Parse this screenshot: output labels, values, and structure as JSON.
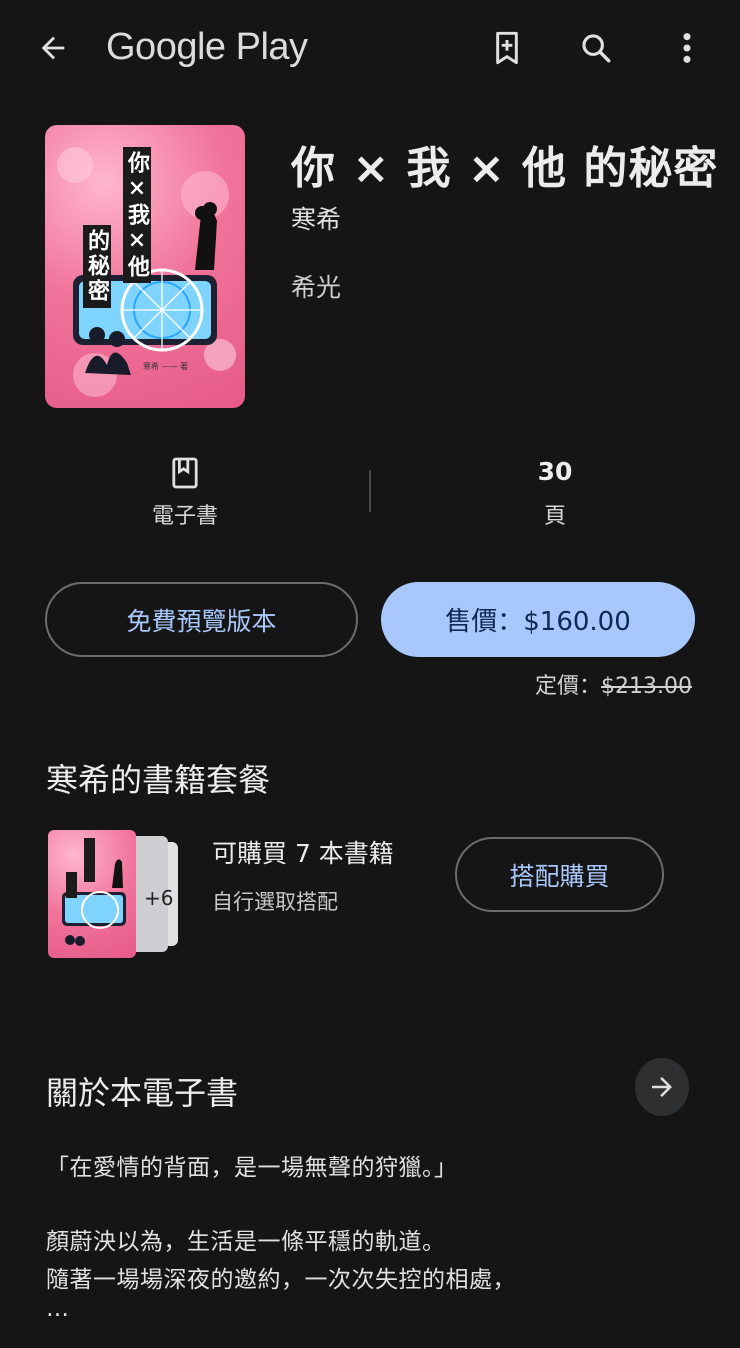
{
  "app_bar": {
    "title": "Google Play",
    "icons": [
      "back-arrow-icon",
      "bookmark-add-icon",
      "search-icon",
      "more-vert-icon"
    ]
  },
  "book": {
    "title": "你 × 我 × 他 的秘密",
    "author": "寒希",
    "publisher": "希光",
    "cover": {
      "title_chars": "你×我×他",
      "subtitle_chars": "的秘密",
      "credit": "寒希 —— 著"
    }
  },
  "info": {
    "format_label": "電子書",
    "pages_value": "30",
    "pages_label": "頁"
  },
  "actions": {
    "preview_label": "免費預覽版本",
    "buy_label": "售價：$160.00",
    "list_price_prefix": "定價：",
    "list_price_value": "$213.00"
  },
  "bundle": {
    "section_title": "寒希的書籍套餐",
    "extra_count": "+6",
    "count_text": "可購買 7 本書籍",
    "subtitle": "自行選取搭配",
    "button_label": "搭配購買"
  },
  "about": {
    "section_title": "關於本電子書",
    "lines": [
      "「在愛情的背面，是一場無聲的狩獵。」",
      "顏蔚泱以為，生活是一條平穩的軌道。",
      "隨著一場場深夜的邀約，一次次失控的相處，",
      "…"
    ]
  },
  "colors": {
    "background": "#151515",
    "accent": "#a8c7fa",
    "accent_text": "#0b2a55"
  }
}
